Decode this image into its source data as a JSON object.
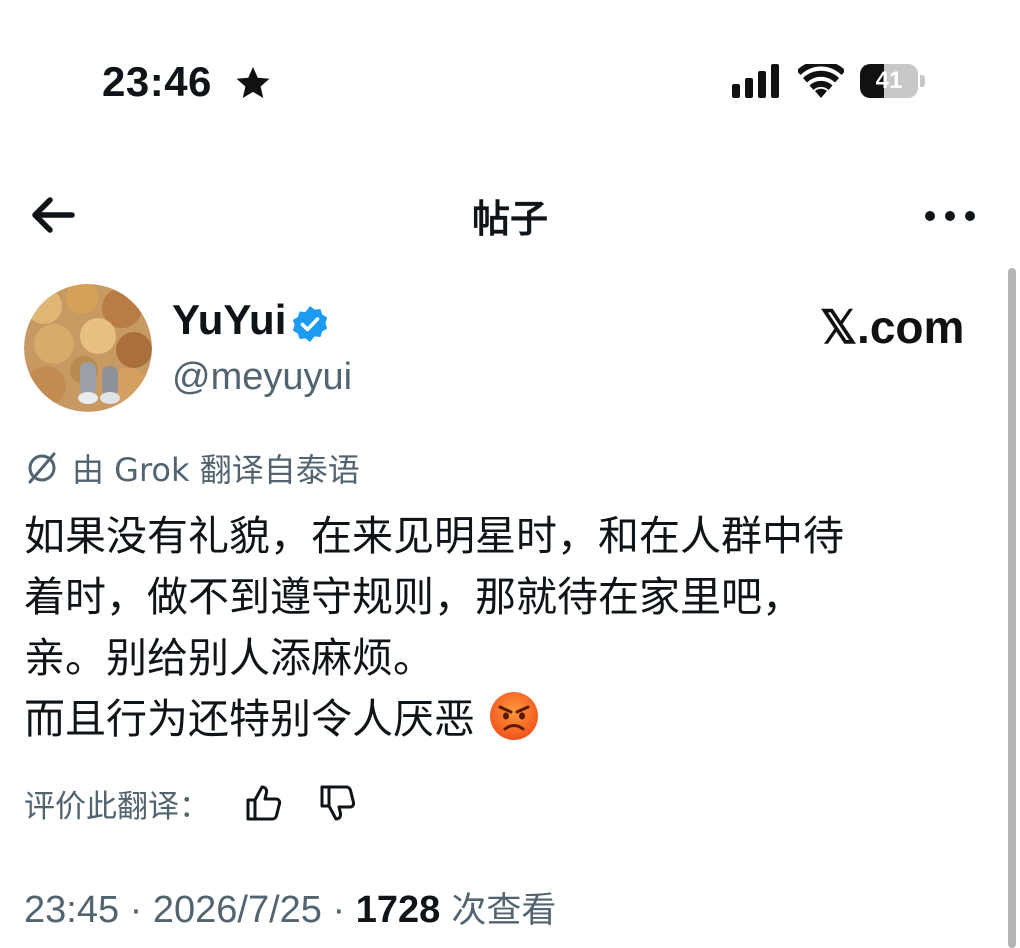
{
  "status_bar": {
    "time": "23:46",
    "battery_level": "41",
    "battery_percent": 41
  },
  "header": {
    "title": "帖子"
  },
  "author": {
    "display_name": "YuYui",
    "handle": "@meyuyui",
    "verified": true
  },
  "watermark": "𝕏.com",
  "translation": {
    "note": "由 Grok 翻译自泰语",
    "rate_label": "评价此翻译："
  },
  "post": {
    "lines": [
      "如果没有礼貌，在来见明星时，和在人群中待",
      "着时，做不到遵守规则，那就待在家里吧，",
      "亲。别给别人添麻烦。",
      "而且行为还特别令人厌恶"
    ],
    "emoji": "angry-face"
  },
  "meta": {
    "time": "23:45",
    "sep1": " · ",
    "date": "2026/7/25",
    "sep2": " · ",
    "views_count": "1728",
    "views_label": " 次查看"
  },
  "colors": {
    "text_primary": "#0f1419",
    "text_secondary": "#536471",
    "verified_blue": "#1d9bf0"
  }
}
